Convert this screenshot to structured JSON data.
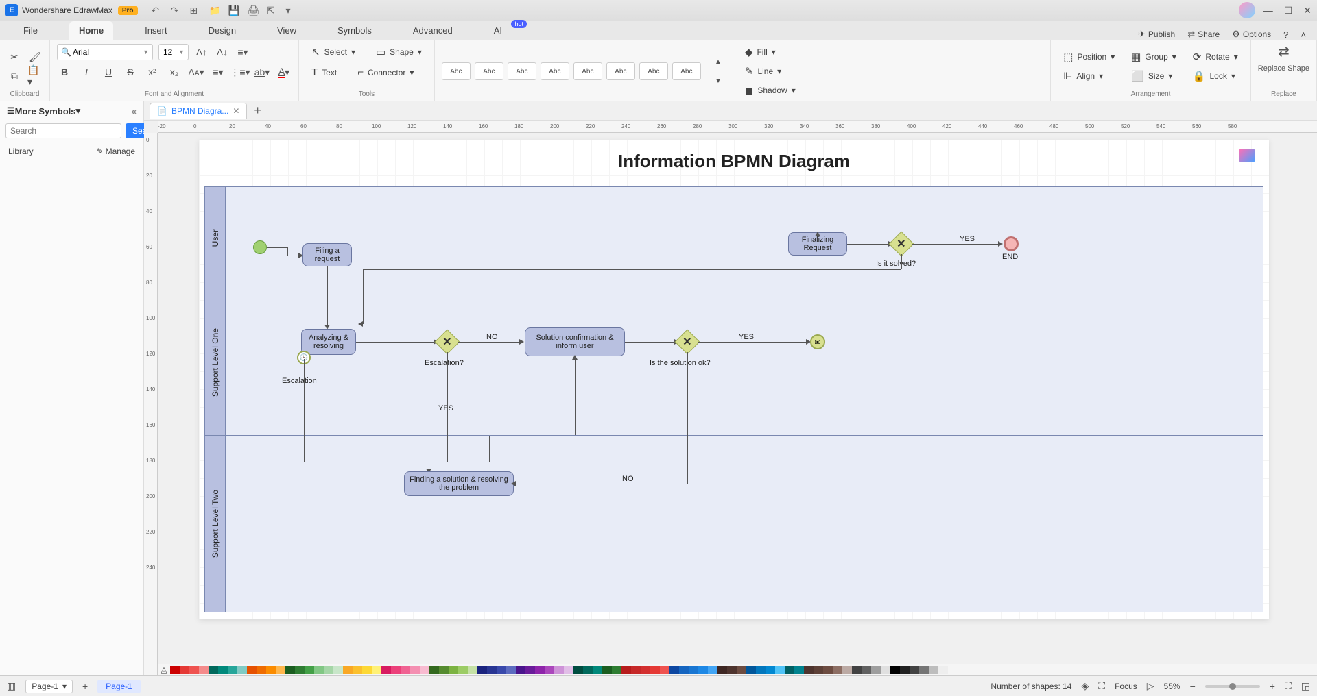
{
  "titlebar": {
    "app_name": "Wondershare EdrawMax",
    "pro": "Pro"
  },
  "menu": {
    "tabs": [
      "File",
      "Home",
      "Insert",
      "Design",
      "View",
      "Symbols",
      "Advanced",
      "AI"
    ],
    "active": "Home",
    "hot": "hot",
    "publish": "Publish",
    "share": "Share",
    "options": "Options"
  },
  "ribbon": {
    "clipboard": "Clipboard",
    "font_alignment": "Font and Alignment",
    "font_name": "Arial",
    "font_size": "12",
    "tools": "Tools",
    "select": "Select",
    "shape": "Shape",
    "text": "Text",
    "connector": "Connector",
    "styles": "Styles",
    "style_swatch": "Abc",
    "fill": "Fill",
    "line": "Line",
    "shadow": "Shadow",
    "arrangement": "Arrangement",
    "position": "Position",
    "align": "Align",
    "group": "Group",
    "size": "Size",
    "rotate": "Rotate",
    "lock": "Lock",
    "replace": "Replace",
    "replace_shape": "Replace Shape"
  },
  "sidebar": {
    "title": "More Symbols",
    "search_placeholder": "Search",
    "search_btn": "Search",
    "library": "Library",
    "manage": "Manage"
  },
  "doc": {
    "tab": "BPMN Diagra..."
  },
  "ruler_h": [
    "-20",
    "0",
    "20",
    "40",
    "60",
    "80",
    "100",
    "120",
    "140",
    "160",
    "180",
    "200",
    "220",
    "240",
    "260",
    "280",
    "300",
    "320",
    "340",
    "360",
    "380",
    "400",
    "420",
    "440",
    "460",
    "480",
    "500",
    "520",
    "540",
    "560",
    "580"
  ],
  "ruler_v": [
    "0",
    "20",
    "40",
    "60",
    "80",
    "100",
    "120",
    "140",
    "160",
    "180",
    "200",
    "220",
    "240"
  ],
  "diagram": {
    "title": "Information BPMN Diagram",
    "lanes": {
      "user": "User",
      "level1": "Support Level One",
      "level2": "Support Level Two"
    },
    "tasks": {
      "filing": "Filing a request",
      "finalizing": "Finalizing Request",
      "analyzing": "Analyzing & resolving",
      "confirm": "Solution confirmation & inform user",
      "finding": "Finding a solution & resolving the problem"
    },
    "labels": {
      "end": "END",
      "solved": "Is it solved?",
      "escalation_q": "Escalation?",
      "escalation": "Escalation",
      "solution_ok": "Is the solution ok?",
      "yes": "YES",
      "no": "NO"
    }
  },
  "statusbar": {
    "page_sel": "Page-1",
    "page_tab": "Page-1",
    "shapes": "Number of shapes: 14",
    "focus": "Focus",
    "zoom": "55%"
  },
  "palette": [
    "#cc0000",
    "#e53935",
    "#ef5350",
    "#f48b8b",
    "#00695c",
    "#00897b",
    "#26a69a",
    "#80cbc4",
    "#e65100",
    "#ef6c00",
    "#fb8c00",
    "#ffb74d",
    "#1b5e20",
    "#2e7d32",
    "#43a047",
    "#81c784",
    "#a5d6a7",
    "#c8e6c9",
    "#f9a825",
    "#fbc02d",
    "#fdd835",
    "#fff176",
    "#d81b60",
    "#ec407a",
    "#f06292",
    "#f48fb1",
    "#f8bbd0",
    "#33691e",
    "#558b2f",
    "#7cb342",
    "#9ccc65",
    "#c5e1a5",
    "#1a237e",
    "#283593",
    "#3949ab",
    "#5c6bc0",
    "#4a148c",
    "#6a1b9a",
    "#8e24aa",
    "#ab47bc",
    "#ce93d8",
    "#e1bee7",
    "#004d40",
    "#00695c",
    "#00897b",
    "#1b5e20",
    "#2e7d32",
    "#b71c1c",
    "#c62828",
    "#d32f2f",
    "#e53935",
    "#ef5350",
    "#0d47a1",
    "#1565c0",
    "#1976d2",
    "#1e88e5",
    "#42a5f5",
    "#3e2723",
    "#4e342e",
    "#6d4c41",
    "#01579b",
    "#0277bd",
    "#0288d1",
    "#4fc3f7",
    "#006064",
    "#00838f",
    "#4e342e",
    "#5d4037",
    "#6d4c41",
    "#8d6e63",
    "#bcaaa4",
    "#424242",
    "#616161",
    "#9e9e9e",
    "#e0e0e0",
    "#000000",
    "#212121",
    "#424242",
    "#757575",
    "#bdbdbd",
    "#eeeeee"
  ]
}
